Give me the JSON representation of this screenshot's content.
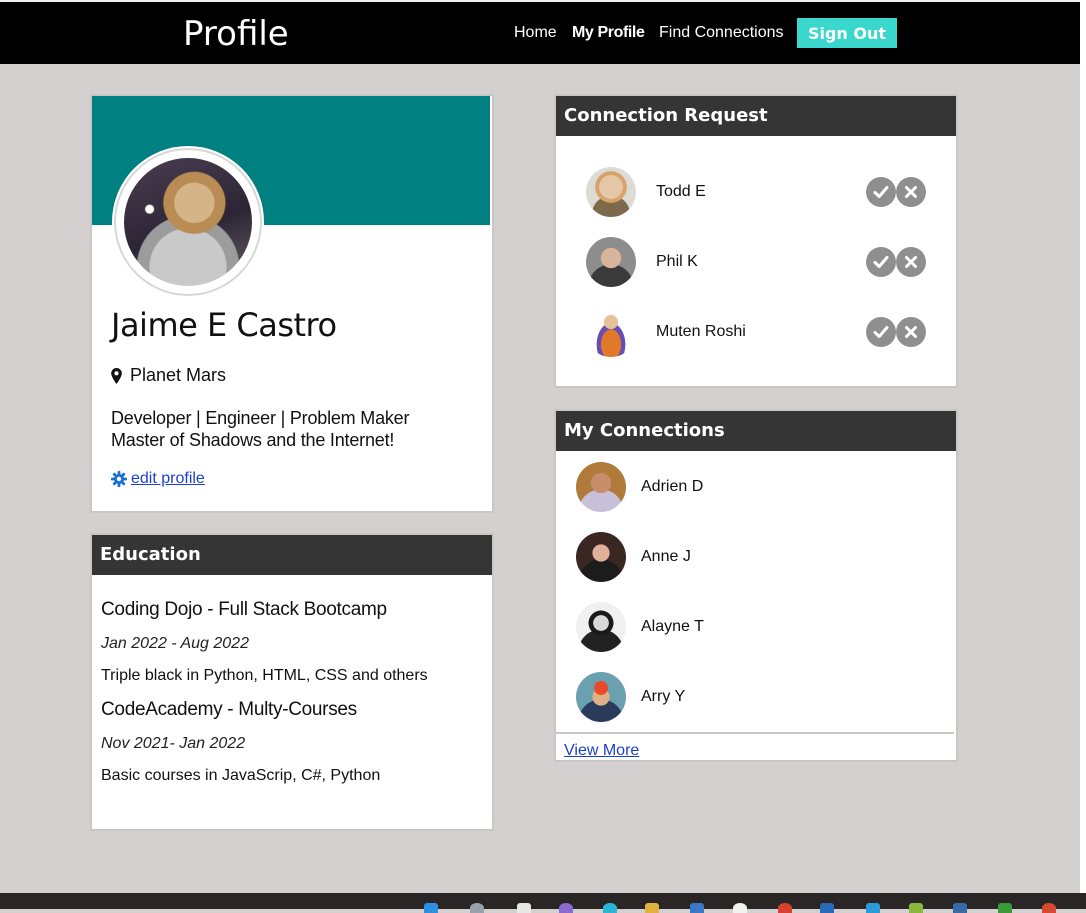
{
  "nav": {
    "brand": "Profile",
    "links": [
      "Home",
      "My Profile",
      "Find Connections"
    ],
    "sign_out": "Sign Out"
  },
  "profile": {
    "name": "Jaime E Castro",
    "location": "Planet Mars",
    "bio_line1": "Developer | Engineer | Problem Maker",
    "bio_line2": "Master of Shadows and the Internet!",
    "edit_label": "edit profile",
    "avatar": "doge-astronaut-avatar"
  },
  "education": {
    "title": "Education",
    "items": [
      {
        "school": "Coding Dojo - Full Stack Bootcamp",
        "dates": "Jan 2022 - Aug 2022",
        "desc": "Triple black in Python, HTML, CSS and others"
      },
      {
        "school": "CodeAcademy - Multy-Courses",
        "dates": "Nov 2021- Jan 2022",
        "desc": "Basic courses in JavaScrip, C#, Python"
      }
    ]
  },
  "requests": {
    "title": "Connection Request",
    "items": [
      {
        "name": "Todd E"
      },
      {
        "name": "Phil K"
      },
      {
        "name": "Muten Roshi"
      }
    ]
  },
  "connections": {
    "title": "My Connections",
    "items": [
      {
        "name": "Adrien D"
      },
      {
        "name": "Anne J"
      },
      {
        "name": "Alayne T"
      },
      {
        "name": "Arry Y"
      }
    ],
    "view_more": "View More"
  },
  "colors": {
    "accent": "#3ad8cc",
    "banner": "#008080",
    "card_header": "#353535",
    "background": "#d3d0cf",
    "link": "#1b3fd1"
  }
}
